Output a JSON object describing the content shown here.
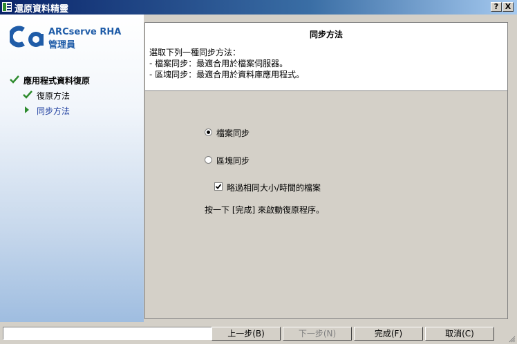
{
  "window": {
    "title": "還原資料精靈",
    "help_label": "?",
    "close_label": "X"
  },
  "sidebar": {
    "brand_line1": "ARCserve RHA",
    "brand_line2": "管理員",
    "steps": [
      {
        "label": "應用程式資料復原",
        "state": "done"
      },
      {
        "label": "復原方法",
        "state": "done"
      },
      {
        "label": "同步方法",
        "state": "current"
      }
    ]
  },
  "header": {
    "title": "同步方法",
    "lines": [
      "選取下列一種同步方法：",
      "- 檔案同步：最適合用於檔案伺服器。",
      "- 區塊同步：最適合用於資料庫應用程式。"
    ]
  },
  "options": {
    "file_sync": {
      "label": "檔案同步",
      "selected": true
    },
    "block_sync": {
      "label": "區塊同步",
      "selected": false
    },
    "skip_same": {
      "label": "略過相同大小/時間的檔案",
      "checked": true
    }
  },
  "instruction": "按一下 [完成] 來啟動復原程序。",
  "buttons": {
    "back": "上一步(B)",
    "next": "下一步(N)",
    "finish": "完成(F)",
    "cancel": "取消(C)"
  },
  "colors": {
    "title_start": "#0a246a",
    "title_end": "#a6caf0",
    "brand": "#1f5ca8",
    "check": "#2e8b2e"
  }
}
